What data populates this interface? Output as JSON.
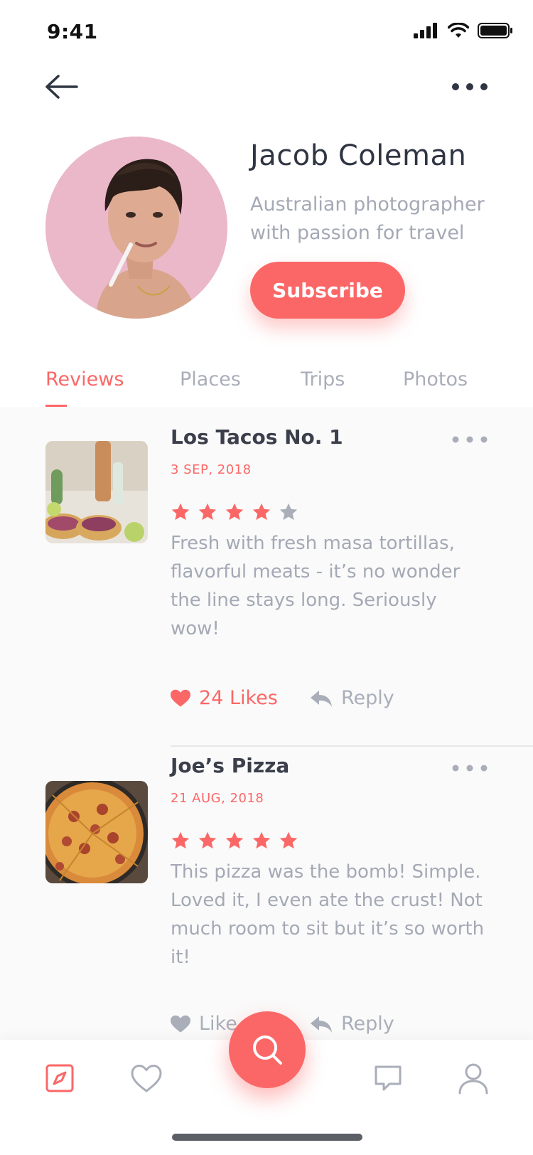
{
  "status_bar": {
    "time": "9:41"
  },
  "header": {
    "back_icon": "back-arrow-icon",
    "more_icon": "more-dots-icon"
  },
  "profile": {
    "name": "Jacob Coleman",
    "bio_line1": "Australian photographer",
    "bio_line2": "with passion for travel",
    "subscribe_label": "Subscribe"
  },
  "tabs": [
    {
      "label": "Reviews",
      "active": true
    },
    {
      "label": "Places",
      "active": false
    },
    {
      "label": "Trips",
      "active": false
    },
    {
      "label": "Photos",
      "active": false
    }
  ],
  "reviews": [
    {
      "title": "Los Tacos No. 1",
      "date": "3 SEP, 2018",
      "rating": 4,
      "text": "Fresh with fresh masa tortillas, flavorful meats - it’s no wonder the line stays long. Seriously wow!",
      "likes_label": "24 Likes",
      "reply_label": "Reply"
    },
    {
      "title": "Joe’s Pizza",
      "date": "21 AUG, 2018",
      "rating": 5,
      "text": "This pizza was the bomb! Simple. Loved it, I even ate the crust! Not much room to sit but it’s so worth it!",
      "likes_label": "Like",
      "reply_label": "Reply"
    }
  ],
  "bottom_nav": {
    "items": [
      "compass-icon",
      "heart-icon",
      "search-icon",
      "chat-icon",
      "profile-icon"
    ],
    "active": "compass-icon"
  },
  "colors": {
    "accent": "#fb6767",
    "muted": "#a4a9b5",
    "text": "#2f3542"
  }
}
